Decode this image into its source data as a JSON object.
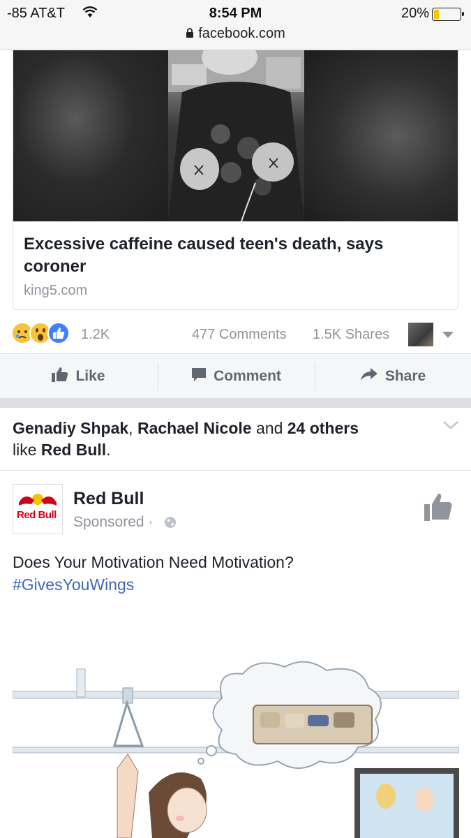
{
  "status_bar": {
    "carrier": "-85 AT&T",
    "time": "8:54 PM",
    "battery": "20%",
    "battery_level": 0.2,
    "url": "facebook.com"
  },
  "link_card": {
    "title": "Excessive caffeine caused teen's death, says coroner",
    "domain": "king5.com"
  },
  "reactions": {
    "icons": [
      "sad-reaction-icon",
      "wow-reaction-icon",
      "like-reaction-icon"
    ],
    "count": "1.2K",
    "comments": "477 Comments",
    "shares": "1.5K Shares"
  },
  "actions": {
    "like": "Like",
    "comment": "Comment",
    "share": "Share"
  },
  "social_context": {
    "friend1": "Genadiy Shpak",
    "sep": ", ",
    "friend2": "Rachael Nicole",
    "and": " and ",
    "others": "24 others",
    "like_text": "like ",
    "page": "Red Bull",
    "period": "."
  },
  "post": {
    "page_name": "Red Bull",
    "logo_text": "Red Bull",
    "sponsored": "Sponsored · ",
    "text": "Does Your Motivation Need Motivation?",
    "hashtag": "#GivesYouWings"
  },
  "colors": {
    "link_blue": "#4267b2",
    "meta_gray": "#90949c",
    "red_bull_red": "#d0021b",
    "red_bull_yellow": "#f5c400"
  }
}
